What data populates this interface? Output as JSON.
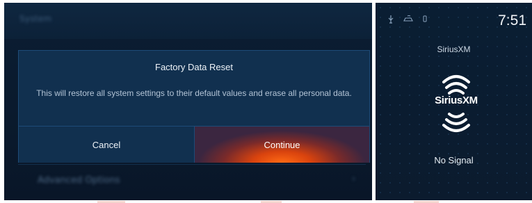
{
  "background_header": {
    "title": "System"
  },
  "background_list": {
    "item_label": "Advanced Options"
  },
  "dialog": {
    "title": "Factory Data Reset",
    "message": "This will restore all system settings to their default values and erase all personal data.",
    "cancel_label": "Cancel",
    "continue_label": "Continue"
  },
  "status_bar": {
    "icons": [
      "usb-icon",
      "connected-car-icon",
      "phone-icon"
    ],
    "time": "7:51"
  },
  "audio_panel": {
    "source_label": "SiriusXM",
    "logo_text": "SiriusXM",
    "status": "No Signal"
  },
  "colors": {
    "accent": "#ff6a14",
    "dialog_bg": "#11304f",
    "screen_bg": "#0b1d33"
  }
}
